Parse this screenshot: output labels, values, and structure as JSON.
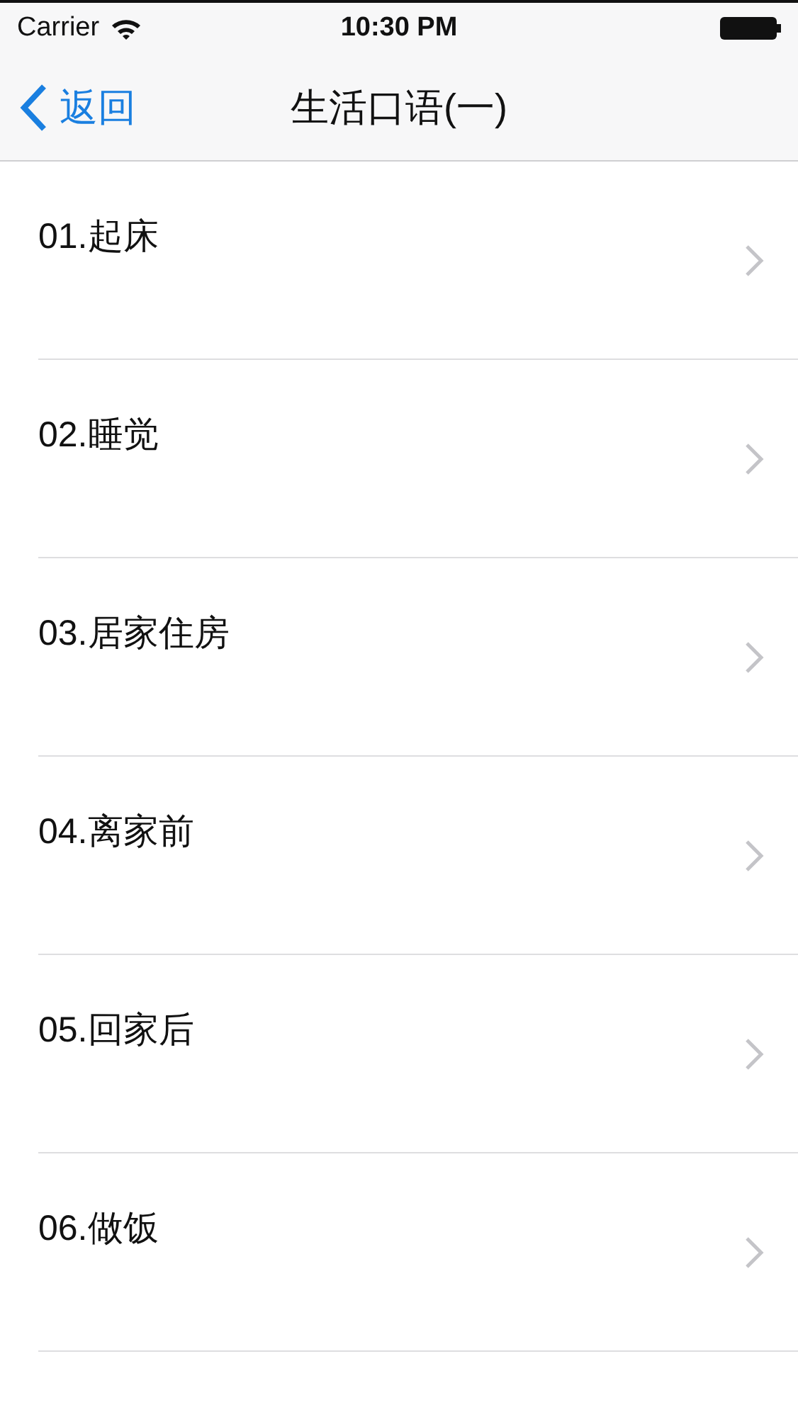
{
  "status_bar": {
    "carrier": "Carrier",
    "time": "10:30 PM"
  },
  "nav_bar": {
    "back": "返回",
    "title": "生活口语(一)"
  },
  "items": [
    {
      "label": "01.起床"
    },
    {
      "label": "02.睡觉"
    },
    {
      "label": "03.居家住房"
    },
    {
      "label": "04.离家前"
    },
    {
      "label": "05.回家后"
    },
    {
      "label": "06.做饭"
    }
  ]
}
